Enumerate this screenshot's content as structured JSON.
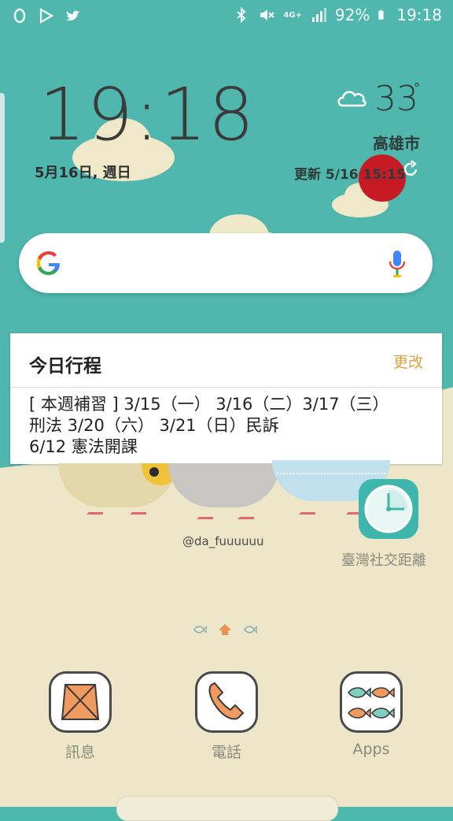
{
  "status_bar": {
    "battery_percent": "92%",
    "time": "19:18",
    "network": "4G+",
    "left_icons": [
      "o-ring-icon",
      "play-store-icon",
      "twitter-icon"
    ],
    "right_icons": [
      "bluetooth-icon",
      "mute-icon",
      "signal-icon",
      "battery-icon"
    ]
  },
  "clock_widget": {
    "time": "19:18",
    "date": "5月16日, 週日"
  },
  "weather_widget": {
    "temperature": "33",
    "degree_symbol": "°",
    "city": "高雄市",
    "updated": "更新 5/16 15:15"
  },
  "search": {
    "colors": {
      "g_blue": "#4285F4",
      "g_red": "#EA4335",
      "g_yellow": "#FBBC05",
      "g_green": "#34A853"
    }
  },
  "schedule_card": {
    "title": "今日行程",
    "edit_label": "更改",
    "lines": [
      "[ 本週補習 ] 3/15（一） 3/16（二）3/17（三）",
      "刑法 3/20（六） 3/21（日）民訴",
      "6/12 憲法開課"
    ]
  },
  "wallpaper": {
    "credit": "@da_fuuuuuu"
  },
  "apps": {
    "social_distance_label": "臺灣社交距離"
  },
  "dock": {
    "messages_label": "訊息",
    "phone_label": "電話",
    "apps_label": "Apps"
  },
  "colors": {
    "teal": "#4fb7ad",
    "cream": "#ede6c8",
    "accent_orange": "#e0a03f",
    "sun_red": "#c61b24"
  }
}
